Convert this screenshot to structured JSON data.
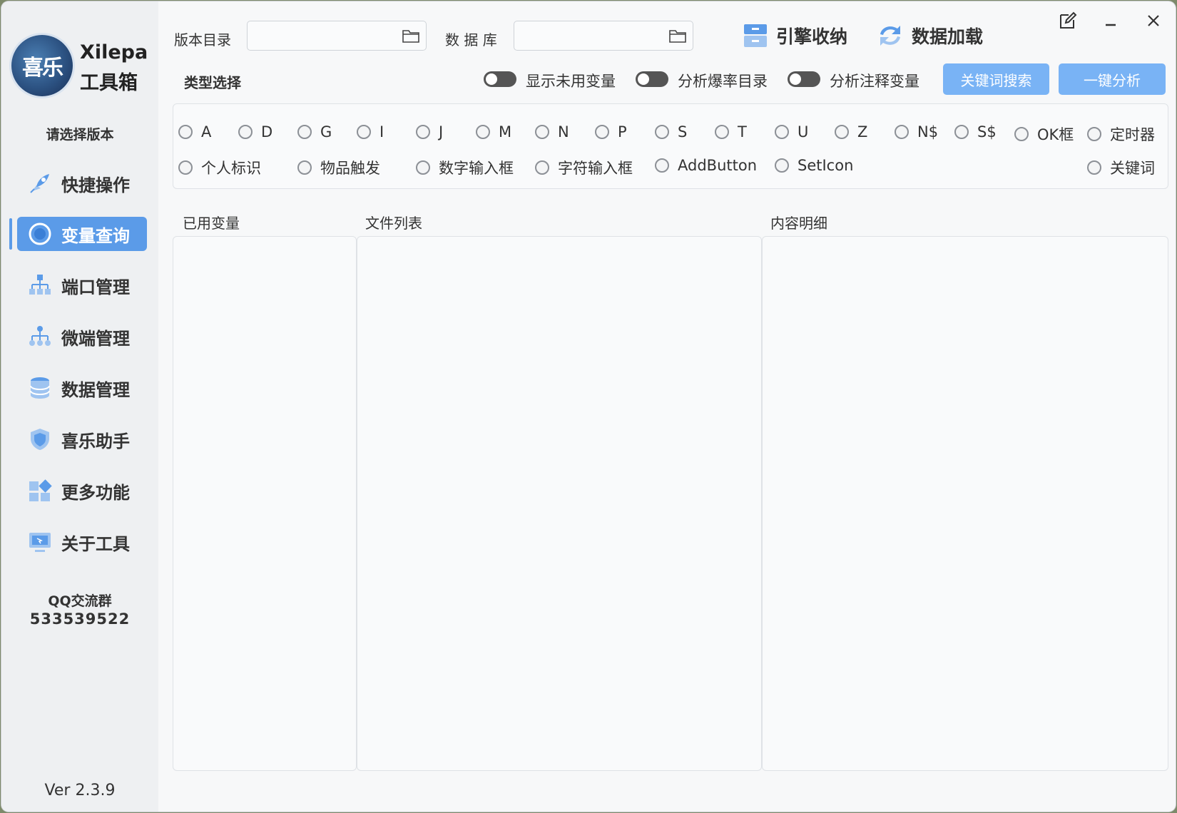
{
  "sidebar": {
    "logo_text": "喜乐",
    "brand_line1": "Xilepa",
    "brand_line2": "工具箱",
    "version_prompt": "请选择版本",
    "items": [
      {
        "label": "快捷操作",
        "icon": "rocket-icon"
      },
      {
        "label": "变量查询",
        "icon": "query-icon",
        "active": true
      },
      {
        "label": "端口管理",
        "icon": "network-icon"
      },
      {
        "label": "微端管理",
        "icon": "tree-icon"
      },
      {
        "label": "数据管理",
        "icon": "database-icon"
      },
      {
        "label": "喜乐助手",
        "icon": "shield-icon"
      },
      {
        "label": "更多功能",
        "icon": "apps-icon"
      },
      {
        "label": "关于工具",
        "icon": "monitor-icon"
      }
    ],
    "qq_label": "QQ交流群",
    "qq_number": "533539522",
    "version": "Ver 2.3.9"
  },
  "header": {
    "version_dir_label": "版本目录",
    "version_dir_value": "",
    "database_label": "数 据 库",
    "database_value": "",
    "engine_button": "引擎收纳",
    "load_button": "数据加载"
  },
  "options": {
    "type_label": "类型选择",
    "toggles": [
      {
        "label": "显示未用变量",
        "on": false
      },
      {
        "label": "分析爆率目录",
        "on": false
      },
      {
        "label": "分析注释变量",
        "on": false
      }
    ],
    "keyword_search_button": "关键词搜索",
    "analyze_button": "一键分析"
  },
  "radios": {
    "row1": [
      "A",
      "D",
      "G",
      "I",
      "J",
      "M",
      "N",
      "P",
      "S",
      "T",
      "U",
      "Z",
      "N$",
      "S$",
      "OK框",
      "定时器"
    ],
    "row2": [
      "个人标识",
      "物品触发",
      "数字输入框",
      "字符输入框",
      "AddButton",
      "SetIcon",
      "关键词"
    ]
  },
  "columns": {
    "used_vars": "已用变量",
    "file_list": "文件列表",
    "content_detail": "内容明细"
  },
  "colors": {
    "accent": "#5b9be8",
    "button": "#79b3f5",
    "sidebar_bg": "#eef0f2"
  }
}
